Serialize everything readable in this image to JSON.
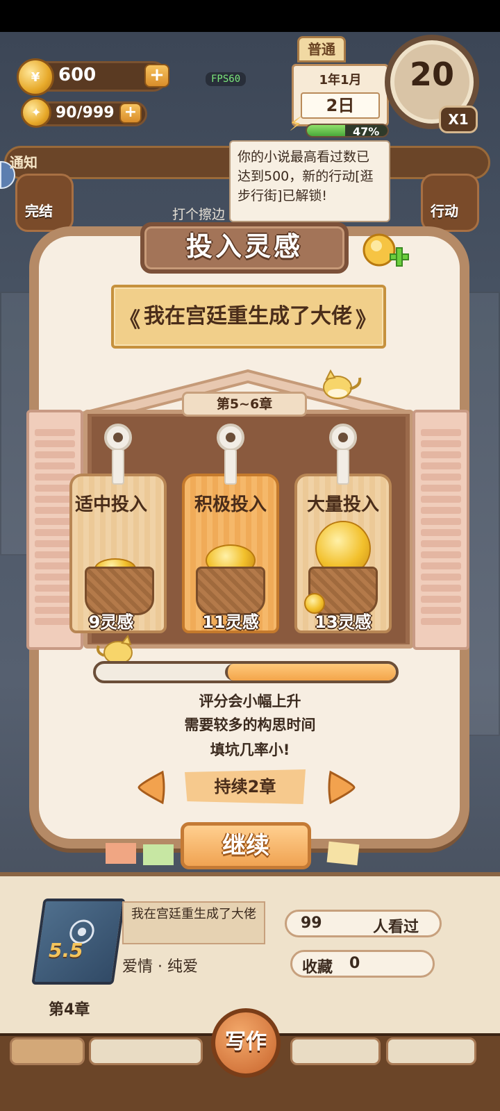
{
  "hud": {
    "coins": "600",
    "inspiration": "90/999",
    "fps": "FPS60",
    "mode_tag": "普通",
    "date_year_month": "1年1月",
    "date_day": "2日",
    "energy_percent": "47%",
    "energy_fraction": 0.47,
    "clock_value": "20",
    "speed": "X1"
  },
  "notice": {
    "label": "通知",
    "tooltip": "你的小说最高看过数已达到500，新的行动[逛步行街]已解锁!"
  },
  "side": {
    "left_top_label": "完结",
    "right_top_label": "行动",
    "center_hint": "打个擦边"
  },
  "modal": {
    "title": "投入灵感",
    "book_title": "我在宫廷重生成了大佬",
    "quote_left": "《",
    "quote_right": "》",
    "chapter_range": "第5~6章",
    "options": [
      {
        "label": "适中投入",
        "cost": "9灵感"
      },
      {
        "label": "积极投入",
        "cost": "11灵感"
      },
      {
        "label": "大量投入",
        "cost": "13灵感"
      }
    ],
    "progress_fraction": 0.43,
    "descriptions": [
      "评分会小幅上升",
      "需要较多的构思时间",
      "填坑几率小!"
    ],
    "duration": "持续2章",
    "continue_label": "继续"
  },
  "bottom": {
    "book_rating": "5.5",
    "book_title": "我在宫廷重生成了大佬",
    "genre": "爱情 · 纯爱",
    "viewers_count": "99",
    "viewers_label": "人看过",
    "favorites_label": "收藏",
    "favorites_count": "0",
    "chapter": "第4章",
    "write_label": "写作"
  },
  "colors": {
    "accent_orange": "#f0a352",
    "panel_cream": "#f7eee2",
    "wood_brown": "#b58a66"
  }
}
